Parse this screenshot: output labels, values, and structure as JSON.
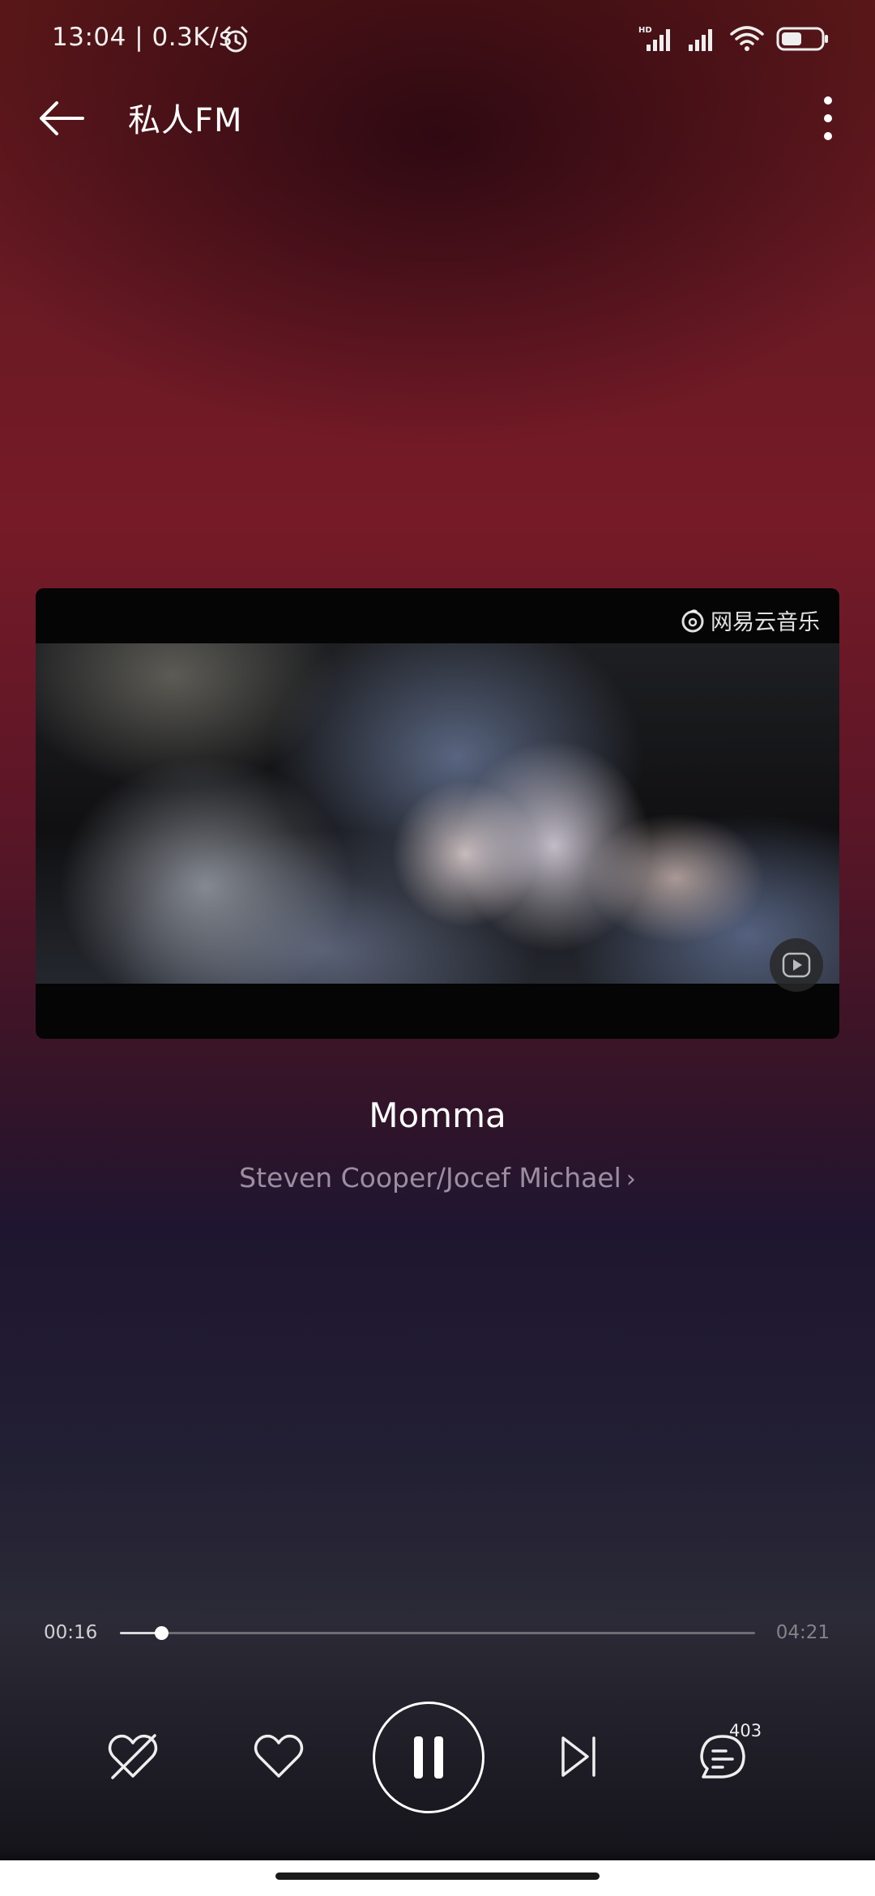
{
  "status_bar": {
    "time": "13:04 | 0.3K/s",
    "icons": [
      "alarm-icon",
      "hd-signal-icon",
      "signal-icon",
      "wifi-icon",
      "battery-icon"
    ],
    "hd_label": "HD"
  },
  "header": {
    "title": "私人FM",
    "back_icon": "arrow-left-icon",
    "more_icon": "more-vertical-icon"
  },
  "video": {
    "watermark": "网易云音乐",
    "play_icon": "video-play-icon"
  },
  "song": {
    "title": "Momma",
    "artist": "Steven Cooper/Jocef Michael"
  },
  "progress": {
    "current": "00:16",
    "total": "04:21",
    "fraction": 0.065
  },
  "controls": {
    "dislike_icon": "dislike-heart-icon",
    "like_icon": "heart-icon",
    "pause_icon": "pause-icon",
    "next_icon": "skip-next-icon",
    "comment_icon": "comment-icon",
    "comment_count": "403"
  },
  "colors": {
    "accent": "#ffffff",
    "background_top": "#5a1718",
    "background_bottom": "#0b0b0f"
  }
}
